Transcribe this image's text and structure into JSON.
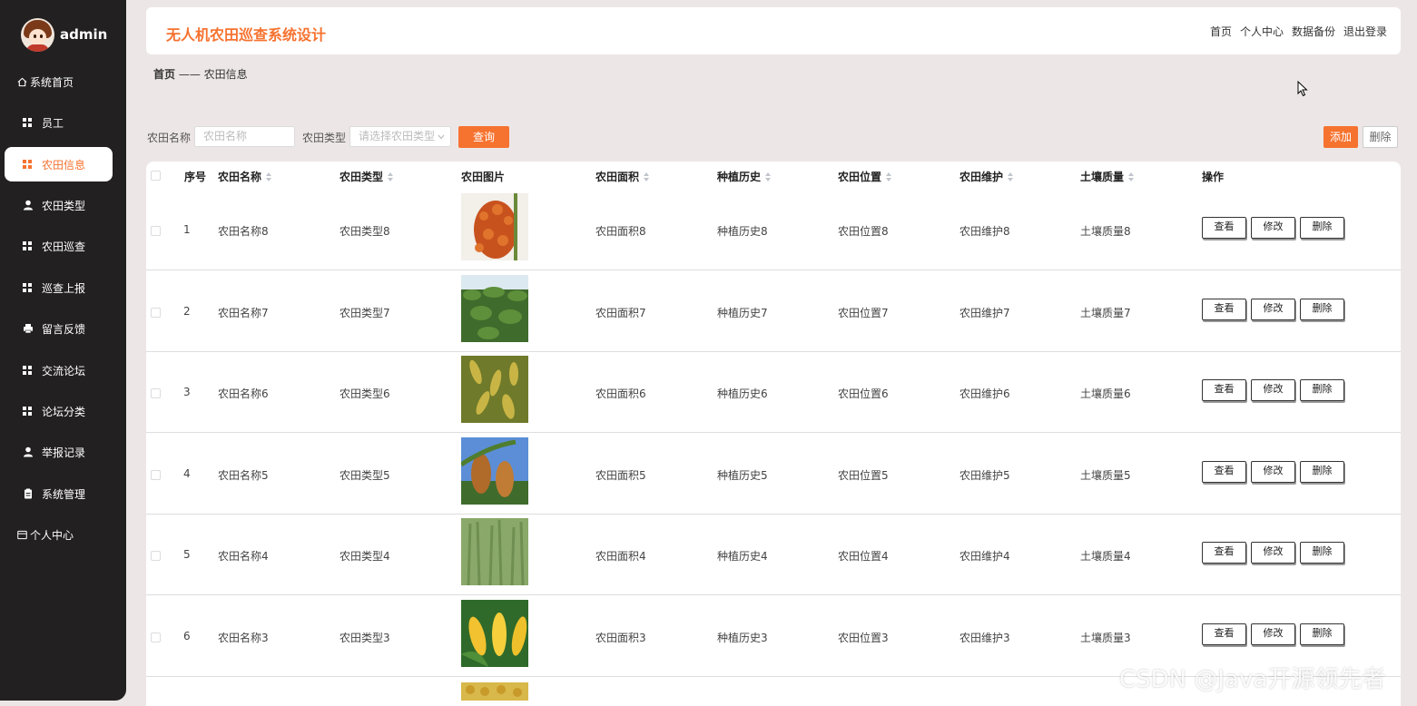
{
  "sidebar": {
    "brand": "admin",
    "items": [
      {
        "label": "系统首页",
        "icon": "home-icon"
      },
      {
        "label": "员工",
        "icon": "grid-icon"
      },
      {
        "label": "农田信息",
        "icon": "grid-icon"
      },
      {
        "label": "农田类型",
        "icon": "user-icon"
      },
      {
        "label": "农田巡查",
        "icon": "grid-icon"
      },
      {
        "label": "巡查上报",
        "icon": "grid-icon"
      },
      {
        "label": "留言反馈",
        "icon": "printer-icon"
      },
      {
        "label": "交流论坛",
        "icon": "grid-icon"
      },
      {
        "label": "论坛分类",
        "icon": "grid-icon"
      },
      {
        "label": "举报记录",
        "icon": "user-icon"
      },
      {
        "label": "系统管理",
        "icon": "clipboard-icon"
      },
      {
        "label": "个人中心",
        "icon": "card-icon"
      }
    ],
    "active_index": 2
  },
  "header": {
    "title": "无人机农田巡查系统设计",
    "links": [
      "首页",
      "个人中心",
      "数据备份",
      "退出登录"
    ]
  },
  "breadcrumb": {
    "home": "首页",
    "sep": "——",
    "current": "农田信息"
  },
  "search": {
    "name_label": "农田名称",
    "name_placeholder": "农田名称",
    "type_label": "农田类型",
    "type_placeholder": "请选择农田类型",
    "query_button": "查询",
    "add_button": "添加",
    "delete_button": "删除"
  },
  "table": {
    "headers": [
      "序号",
      "农田名称",
      "农田类型",
      "农田图片",
      "农田面积",
      "种植历史",
      "农田位置",
      "农田维护",
      "土壤质量",
      "操作"
    ],
    "actions": [
      "查看",
      "修改",
      "删除"
    ],
    "rows": [
      {
        "no": "1",
        "name": "农田名称8",
        "type": "农田类型8",
        "area": "农田面积8",
        "history": "种植历史8",
        "location": "农田位置8",
        "maintain": "农田维护8",
        "soil": "土壤质量8",
        "image": "sorghum-red"
      },
      {
        "no": "2",
        "name": "农田名称7",
        "type": "农田类型7",
        "area": "农田面积7",
        "history": "种植历史7",
        "location": "农田位置7",
        "maintain": "农田维护7",
        "soil": "土壤质量7",
        "image": "soybean-field"
      },
      {
        "no": "3",
        "name": "农田名称6",
        "type": "农田类型6",
        "area": "农田面积6",
        "history": "种植历史6",
        "location": "农田位置6",
        "maintain": "农田维护6",
        "soil": "土壤质量6",
        "image": "soybean-pods"
      },
      {
        "no": "4",
        "name": "农田名称5",
        "type": "农田类型5",
        "area": "农田面积5",
        "history": "种植历史5",
        "location": "农田位置5",
        "maintain": "农田维护5",
        "soil": "土壤质量5",
        "image": "sorghum-sky"
      },
      {
        "no": "5",
        "name": "农田名称4",
        "type": "农田类型4",
        "area": "农田面积4",
        "history": "种植历史4",
        "location": "农田位置4",
        "maintain": "农田维护4",
        "soil": "土壤质量4",
        "image": "wheat-green"
      },
      {
        "no": "6",
        "name": "农田名称3",
        "type": "农田类型3",
        "area": "农田面积3",
        "history": "种植历史3",
        "location": "农田位置3",
        "maintain": "农田维护3",
        "soil": "土壤质量3",
        "image": "corn-cobs"
      }
    ]
  },
  "watermark": "CSDN @Java开源领先者",
  "colors": {
    "accent": "#f6722f",
    "sidebar": "#222021",
    "background": "#ece7e6"
  }
}
